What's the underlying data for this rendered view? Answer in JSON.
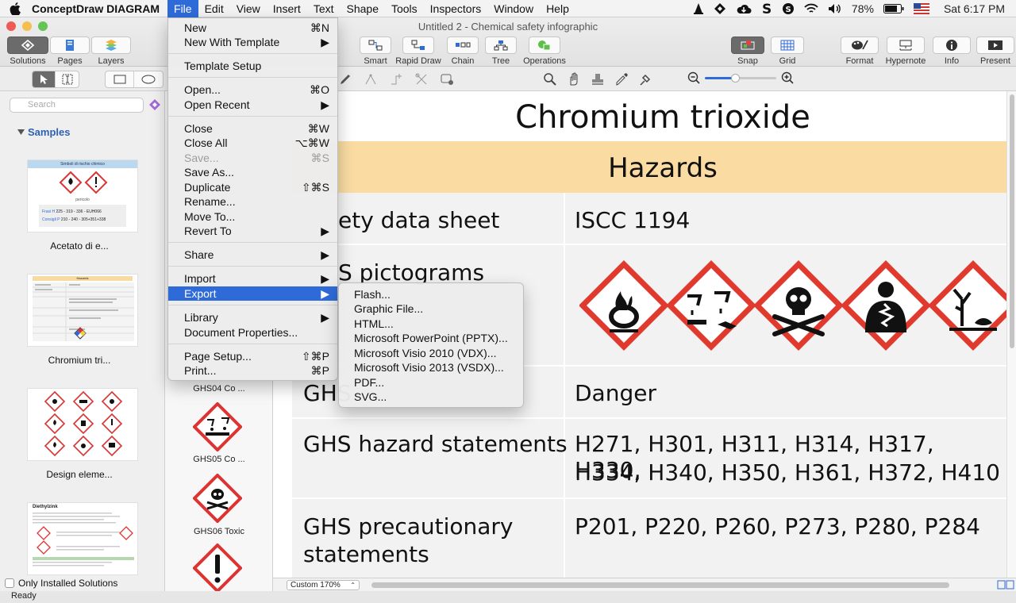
{
  "menubar": {
    "app_name": "ConceptDraw DIAGRAM",
    "items": [
      "File",
      "Edit",
      "View",
      "Insert",
      "Text",
      "Shape",
      "Tools",
      "Inspectors",
      "Window",
      "Help"
    ],
    "active": "File",
    "battery": "78%",
    "clock": "Sat 6:17 PM"
  },
  "window": {
    "title": "Untitled 2 - Chemical safety infographic"
  },
  "toolbar": {
    "left": [
      "Solutions",
      "Pages",
      "Layers"
    ],
    "center": [
      "Smart",
      "Rapid Draw",
      "Chain",
      "Tree",
      "Operations"
    ],
    "snap": "Snap",
    "grid": "Grid",
    "right": [
      "Format",
      "Hypernote",
      "Info",
      "Present"
    ]
  },
  "sidebar": {
    "search_placeholder": "Search",
    "section": "Samples",
    "samples": [
      "Acetato di e...",
      "Chromium tri...",
      "Design eleme..."
    ],
    "only_installed": "Only Installed Solutions"
  },
  "thumb1": {
    "header": "Simboli di rischio chimico",
    "sub": "pericolo",
    "r1a": "Frasi H",
    "r1b": "225 - 319 - 336 - EUH066",
    "r2a": "Consigli P",
    "r2b": "210 - 240 - 305+351+338"
  },
  "thumb2": {
    "header": "Hazards"
  },
  "thumb4": {
    "title": "Diethylzink"
  },
  "symbols": {
    "labels": [
      "GHS04 Co ...",
      "GHS05 Co ...",
      "GHS06 Toxic"
    ]
  },
  "canvas": {
    "title": "Chromium trioxide",
    "hazards": "Hazards",
    "rows": [
      {
        "label": "Safety data sheet",
        "value": "ISCC 1194"
      },
      {
        "label": "GHS pictograms",
        "value": ""
      },
      {
        "label": "GHS signal word",
        "value": "Danger"
      },
      {
        "label": "GHS hazard statements",
        "value": "H271, H301, H311, H314, H317, H330,",
        "value2": "H334, H340, H350, H361, H372, H410"
      },
      {
        "label": "GHS precautionary",
        "label2": "statements",
        "value": "P201, P220, P260, P273, P280, P284"
      }
    ],
    "visible_labels": [
      "ety data sheet",
      "S pictograms",
      "GHS"
    ]
  },
  "file_menu": [
    {
      "label": "New",
      "shortcut": "⌘N"
    },
    {
      "label": "New With Template",
      "shortcut": "▶"
    },
    {
      "label": "Template Setup",
      "shortcut": ""
    },
    {
      "label": "Open...",
      "shortcut": "⌘O"
    },
    {
      "label": "Open Recent",
      "shortcut": "▶"
    },
    {
      "label": "Close",
      "shortcut": "⌘W"
    },
    {
      "label": "Close All",
      "shortcut": "⌥⌘W"
    },
    {
      "label": "Save...",
      "shortcut": "⌘S"
    },
    {
      "label": "Save As...",
      "shortcut": ""
    },
    {
      "label": "Duplicate",
      "shortcut": "⇧⌘S"
    },
    {
      "label": "Rename...",
      "shortcut": ""
    },
    {
      "label": "Move To...",
      "shortcut": ""
    },
    {
      "label": "Revert To",
      "shortcut": "▶"
    },
    {
      "label": "Share",
      "shortcut": "▶"
    },
    {
      "label": "Import",
      "shortcut": "▶"
    },
    {
      "label": "Export",
      "shortcut": "▶"
    },
    {
      "label": "Library",
      "shortcut": "▶"
    },
    {
      "label": "Document Properties...",
      "shortcut": ""
    },
    {
      "label": "Page Setup...",
      "shortcut": "⇧⌘P"
    },
    {
      "label": "Print...",
      "shortcut": "⌘P"
    }
  ],
  "export_menu": [
    "Flash...",
    "Graphic File...",
    "HTML...",
    "Microsoft PowerPoint (PPTX)...",
    "Microsoft Visio 2010 (VDX)...",
    "Microsoft Visio 2013 (VSDX)...",
    "PDF...",
    "SVG..."
  ],
  "statusbar": {
    "zoom": "Custom 170%",
    "status": "Ready"
  }
}
